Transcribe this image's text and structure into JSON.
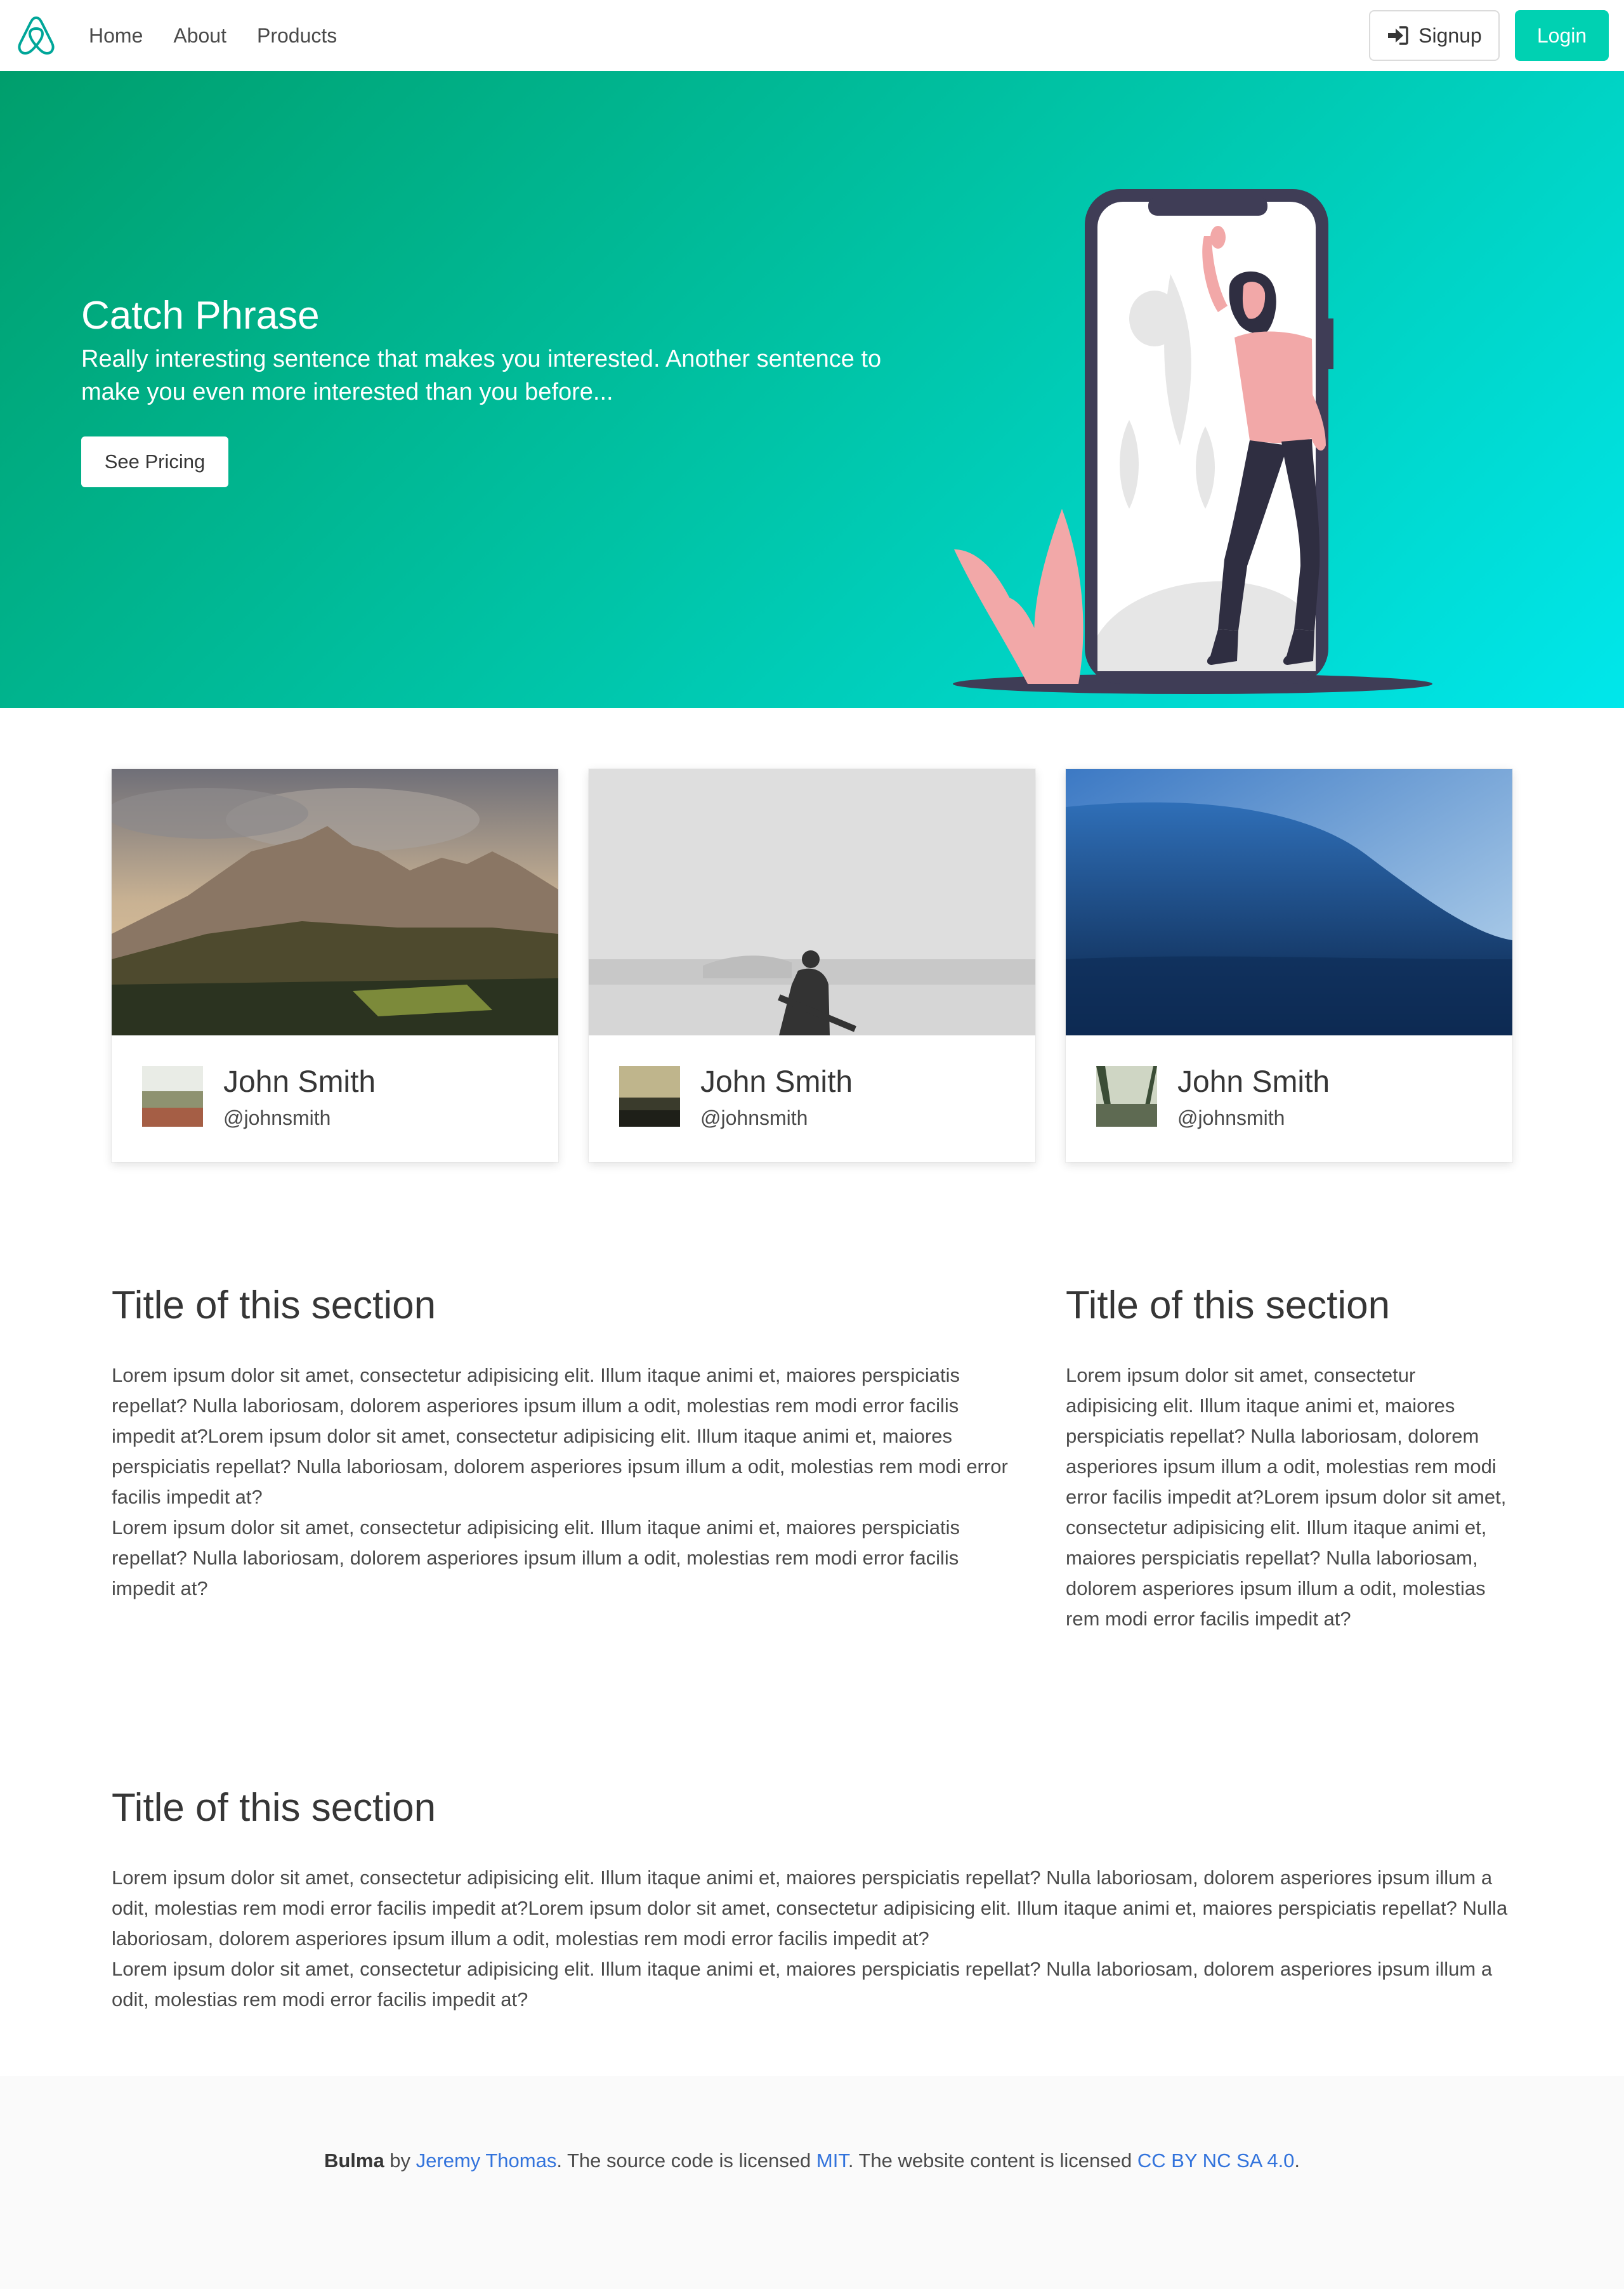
{
  "navbar": {
    "links": [
      "Home",
      "About",
      "Products"
    ],
    "signup_label": "Signup",
    "login_label": "Login"
  },
  "hero": {
    "title": "Catch Phrase",
    "subtitle": "Really interesting sentence that makes you interested. Another sentence to make you even more interested than you before...",
    "button_label": "See Pricing"
  },
  "cards": [
    {
      "name": "John Smith",
      "handle": "@johnsmith"
    },
    {
      "name": "John Smith",
      "handle": "@johnsmith"
    },
    {
      "name": "John Smith",
      "handle": "@johnsmith"
    }
  ],
  "section1": {
    "left_title": "Title of this section",
    "left_p1": "Lorem ipsum dolor sit amet, consectetur adipisicing elit. Illum itaque animi et, maiores perspiciatis repellat? Nulla laboriosam, dolorem asperiores ipsum illum a odit, molestias rem modi error facilis impedit at?Lorem ipsum dolor sit amet, consectetur adipisicing elit. Illum itaque animi et, maiores perspiciatis repellat? Nulla laboriosam, dolorem asperiores ipsum illum a odit, molestias rem modi error facilis impedit at?",
    "left_p2": "Lorem ipsum dolor sit amet, consectetur adipisicing elit. Illum itaque animi et, maiores perspiciatis repellat? Nulla laboriosam, dolorem asperiores ipsum illum a odit, molestias rem modi error facilis impedit at?",
    "right_title": "Title of this section",
    "right_p1": "Lorem ipsum dolor sit amet, consectetur adipisicing elit. Illum itaque animi et, maiores perspiciatis repellat? Nulla laboriosam, dolorem asperiores ipsum illum a odit, molestias rem modi error facilis impedit at?Lorem ipsum dolor sit amet, consectetur adipisicing elit. Illum itaque animi et, maiores perspiciatis repellat? Nulla laboriosam, dolorem asperiores ipsum illum a odit, molestias rem modi error facilis impedit at?"
  },
  "section2": {
    "title": "Title of this section",
    "p1": "Lorem ipsum dolor sit amet, consectetur adipisicing elit. Illum itaque animi et, maiores perspiciatis repellat? Nulla laboriosam, dolorem asperiores ipsum illum a odit, molestias rem modi error facilis impedit at?Lorem ipsum dolor sit amet, consectetur adipisicing elit. Illum itaque animi et, maiores perspiciatis repellat? Nulla laboriosam, dolorem asperiores ipsum illum a odit, molestias rem modi error facilis impedit at?",
    "p2": "Lorem ipsum dolor sit amet, consectetur adipisicing elit. Illum itaque animi et, maiores perspiciatis repellat? Nulla laboriosam, dolorem asperiores ipsum illum a odit, molestias rem modi error facilis impedit at?"
  },
  "footer": {
    "brand": "Bulma",
    "by": " by ",
    "author": "Jeremy Thomas",
    "mid": ". The source code is licensed ",
    "license_code": "MIT",
    "mid2": ". The website content is licensed ",
    "license_content": "CC BY NC SA 4.0",
    "end": "."
  },
  "colors": {
    "primary": "#00d1b2",
    "hero_start": "#009e6c",
    "hero_end": "#00e7eb",
    "link": "#3273dc"
  },
  "icons": [
    "airbnb-logo-icon",
    "sign-in-icon"
  ]
}
